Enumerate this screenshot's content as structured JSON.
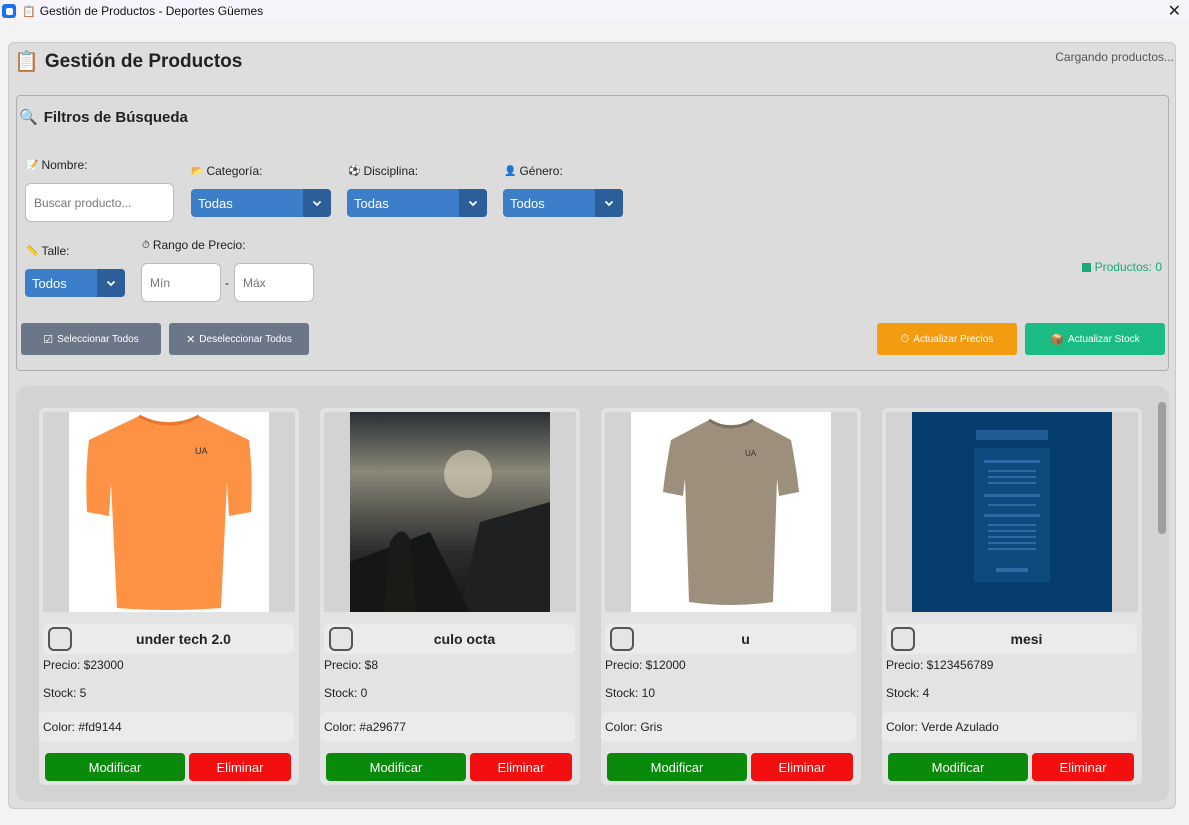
{
  "window": {
    "title": "Gestión de Productos - Deportes Güemes",
    "close_glyph": "✕"
  },
  "header": {
    "title": "Gestión de Productos",
    "status": "Cargando productos..."
  },
  "filters": {
    "title": "Filtros de Búsqueda",
    "nombre_label": "Nombre:",
    "nombre_placeholder": "Buscar producto...",
    "categoria_label": "Categoría:",
    "categoria_value": "Todas",
    "disciplina_label": "Disciplina:",
    "disciplina_value": "Todas",
    "genero_label": "Género:",
    "genero_value": "Todos",
    "talle_label": "Talle:",
    "talle_value": "Todos",
    "precio_label": "Rango de Precio:",
    "min_placeholder": "Mín",
    "max_placeholder": "Máx",
    "range_separator": "-",
    "count_label": "Productos: 0"
  },
  "actions": {
    "select_all": "Seleccionar Todos",
    "deselect_all": "Deseleccionar Todos",
    "update_prices": "Actualizar Precios",
    "update_stock": "Actualizar Stock"
  },
  "products": [
    {
      "name": "under tech 2.0",
      "price": "Precio: $23000",
      "stock": "Stock: 5",
      "color": "Color: #fd9144",
      "image": "orange-tshirt",
      "modify": "Modificar",
      "delete": "Eliminar"
    },
    {
      "name": "culo octa",
      "price": "Precio: $8",
      "stock": "Stock: 0",
      "color": "Color: #a29677",
      "image": "dark-landscape-photo",
      "modify": "Modificar",
      "delete": "Eliminar"
    },
    {
      "name": "u",
      "price": "Precio: $12000",
      "stock": "Stock: 10",
      "color": "Color: Gris",
      "image": "taupe-tshirt",
      "modify": "Modificar",
      "delete": "Eliminar"
    },
    {
      "name": "mesi",
      "price": "Precio: $123456789",
      "stock": "Stock: 4",
      "color": "Color: Verde Azulado",
      "image": "blue-document-image",
      "modify": "Modificar",
      "delete": "Eliminar"
    }
  ],
  "colors": {
    "select_bg": "#3d7ec9",
    "modify_btn": "#0a8a0a",
    "delete_btn": "#f30f0f",
    "update_prices_btn": "#f39c12",
    "update_stock_btn": "#1abc84",
    "neutral_btn": "#6c7689",
    "count_text": "#1aa87a"
  }
}
